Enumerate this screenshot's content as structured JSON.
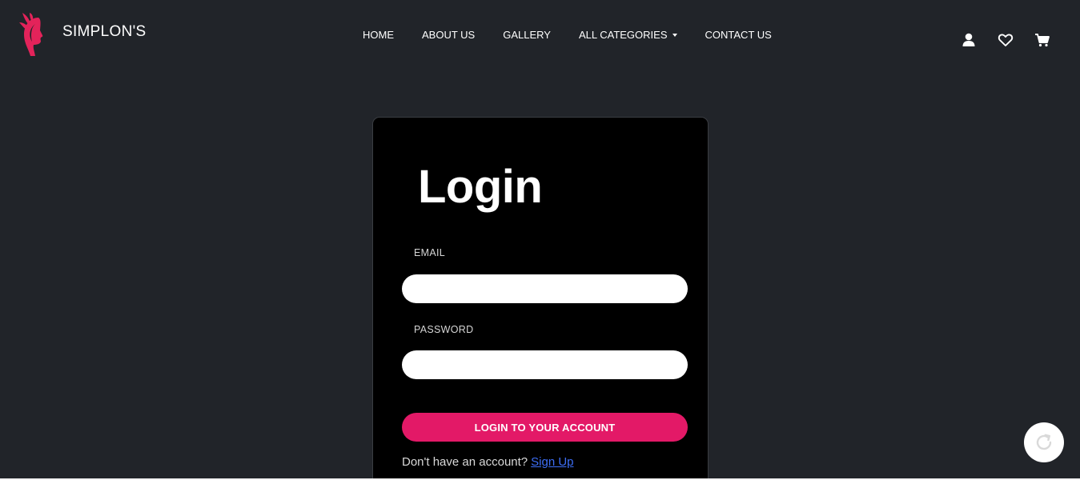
{
  "brand": {
    "name": "SIMPLON'S",
    "logo_icon": "woman-profile-logo-icon",
    "logo_color": "#e3235a"
  },
  "nav": {
    "links": [
      {
        "label": "HOME"
      },
      {
        "label": "ABOUT US"
      },
      {
        "label": "GALLERY"
      },
      {
        "label": "ALL CATEGORIES",
        "dropdown": true
      },
      {
        "label": "CONTACT US"
      }
    ],
    "icons": [
      "user-icon",
      "heart-icon",
      "cart-icon"
    ]
  },
  "login": {
    "title": "Login",
    "email_label": "EMAIL",
    "email_value": "",
    "password_label": "PASSWORD",
    "password_value": "",
    "submit_label": "LOGIN TO YOUR ACCOUNT",
    "signup_prompt": "Don't have an account?",
    "signup_link": "Sign Up"
  },
  "floating_button": {
    "icon": "refresh-icon"
  },
  "colors": {
    "background": "#212429",
    "card": "#000000",
    "accent": "#e31967",
    "link": "#3d6ef5"
  }
}
